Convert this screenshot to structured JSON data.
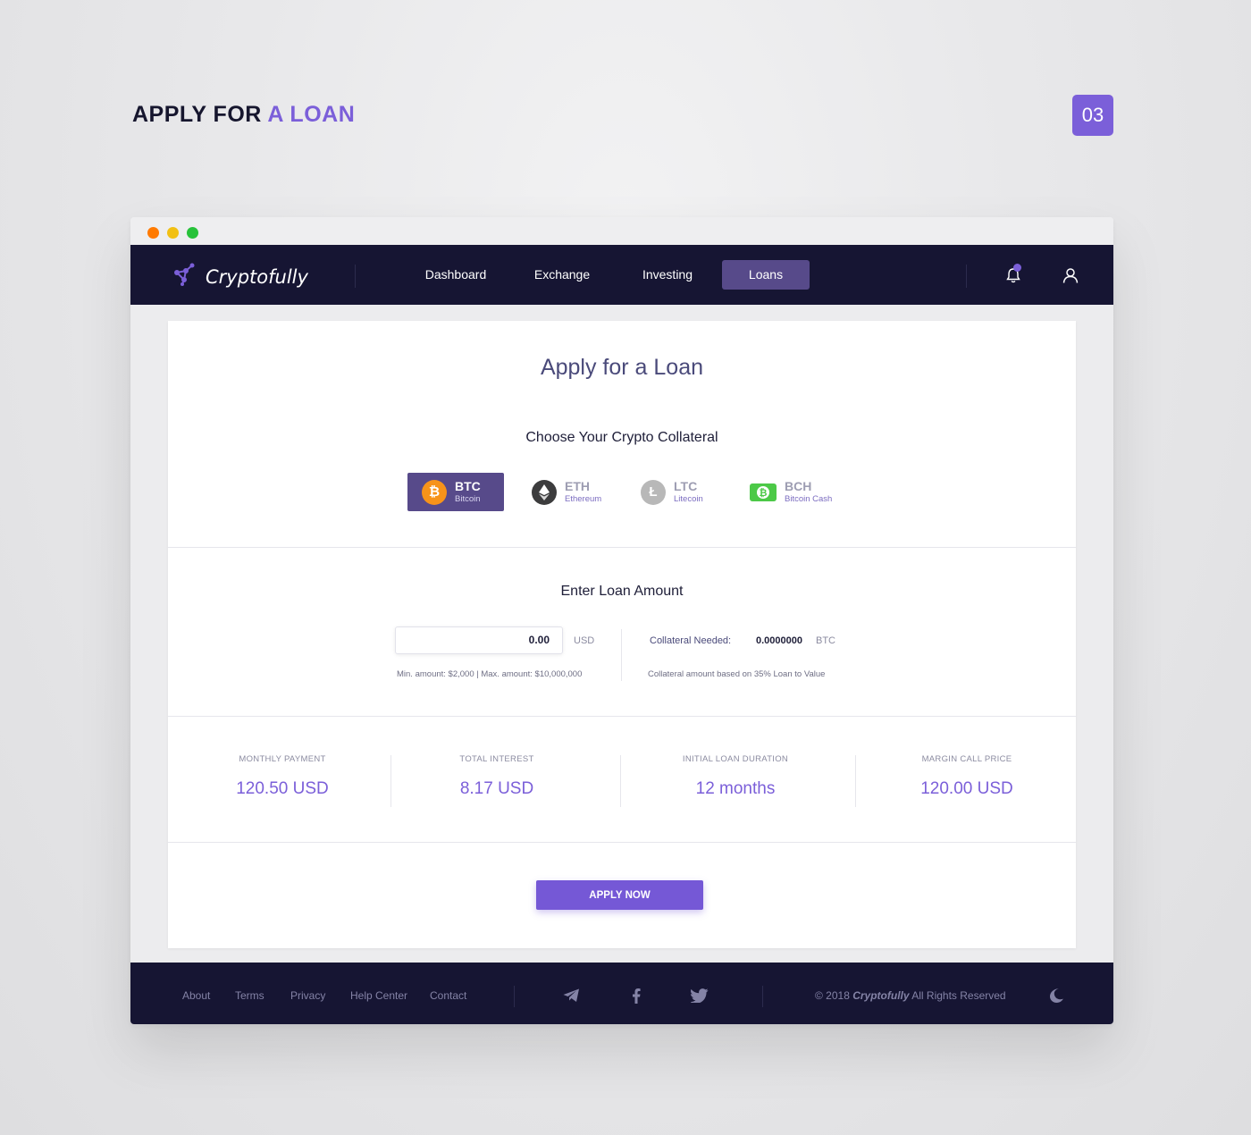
{
  "heading": {
    "prefix": "APPLY FOR",
    "accent": "A LOAN"
  },
  "step_badge": "03",
  "app": {
    "name": "Cryptofully",
    "nav": [
      "Dashboard",
      "Exchange",
      "Investing",
      "Loans"
    ],
    "active_nav": "Loans"
  },
  "card": {
    "title": "Apply for a Loan",
    "collateral_label": "Choose Your Crypto Collateral",
    "coins": [
      {
        "symbol": "BTC",
        "name": "Bitcoin",
        "selected": true,
        "color": "#f7931a"
      },
      {
        "symbol": "ETH",
        "name": "Ethereum",
        "selected": false,
        "color": "#3c3c3d"
      },
      {
        "symbol": "LTC",
        "name": "Litecoin",
        "selected": false,
        "color": "#b8b8b8"
      },
      {
        "symbol": "BCH",
        "name": "Bitcoin Cash",
        "selected": false,
        "color": "#4cc947"
      }
    ],
    "loan_label": "Enter Loan Amount",
    "amount_value": "0.00",
    "amount_unit": "USD",
    "amount_hint": "Min. amount: $2,000 | Max. amount: $10,000,000",
    "collateral_needed_label": "Collateral Needed:",
    "collateral_needed_value": "0.0000000",
    "collateral_needed_unit": "BTC",
    "collateral_hint": "Collateral amount based on 35% Loan to Value",
    "stats": [
      {
        "label": "MONTHLY PAYMENT",
        "value": "120.50 USD"
      },
      {
        "label": "TOTAL INTEREST",
        "value": "8.17 USD"
      },
      {
        "label": "INITIAL LOAN DURATION",
        "value": "12 months"
      },
      {
        "label": "MARGIN CALL PRICE",
        "value": "120.00 USD"
      }
    ],
    "apply_button": "APPLY NOW"
  },
  "footer": {
    "links": [
      "About",
      "Terms",
      "Privacy",
      "Help Center",
      "Contact"
    ],
    "social_icons": [
      "telegram-icon",
      "facebook-icon",
      "twitter-icon"
    ],
    "copyright_prefix": "© 2018",
    "copyright_brand": "Cryptofully",
    "copyright_suffix": "All Rights Reserved"
  },
  "colors": {
    "accent": "#7b5fd9",
    "navbar": "#161533",
    "active_nav": "#574a8a"
  }
}
